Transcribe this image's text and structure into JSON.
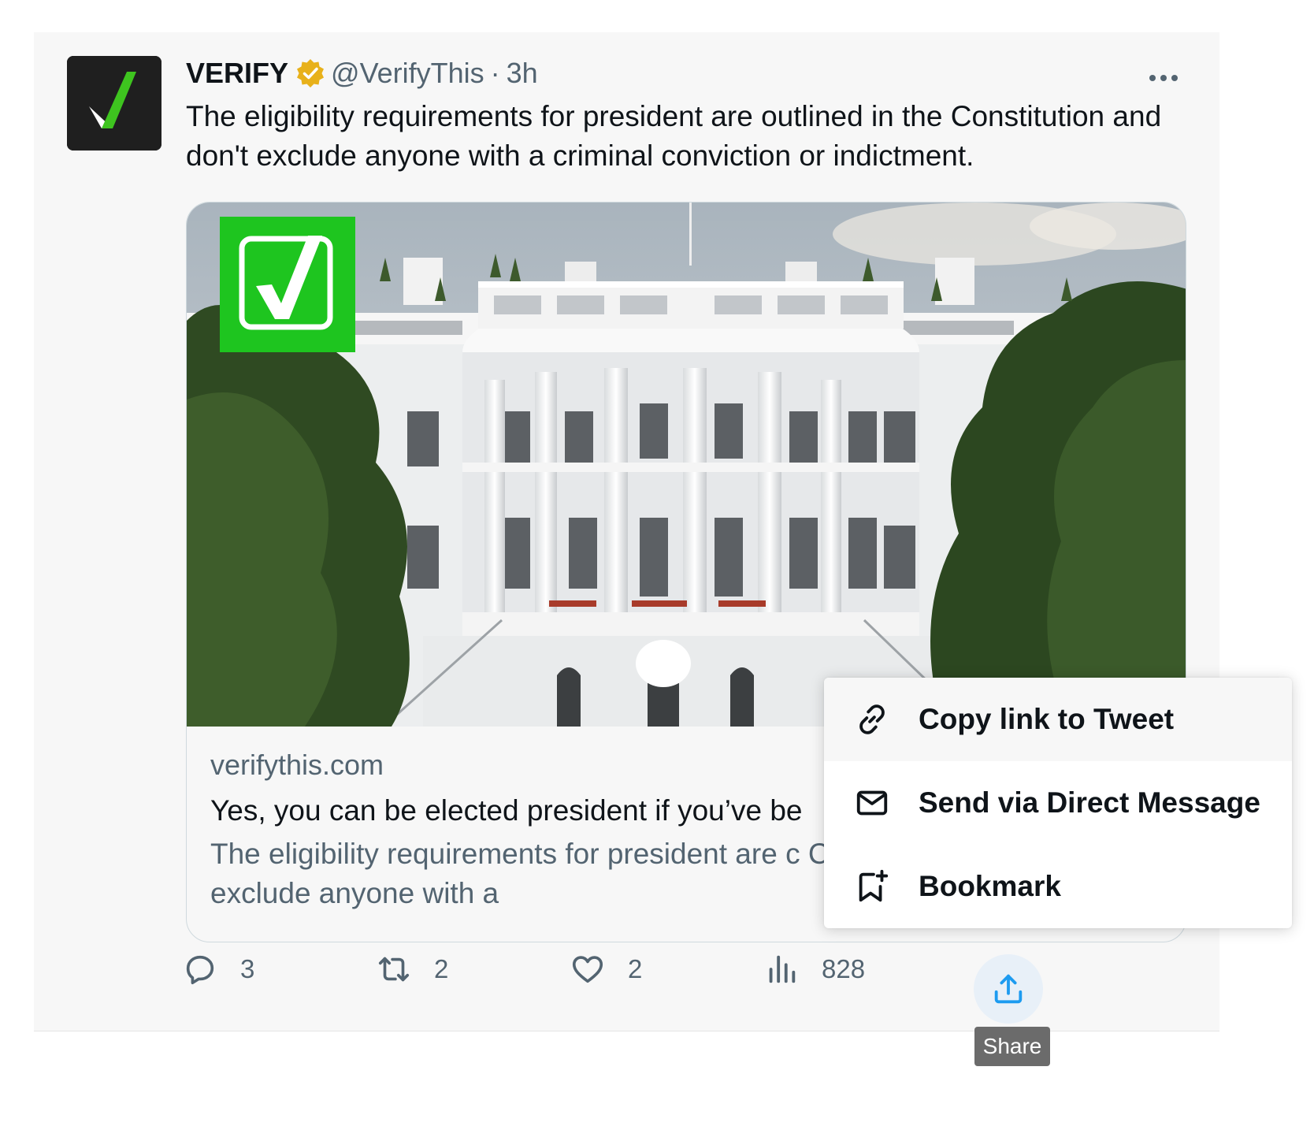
{
  "tweet": {
    "display_name": "VERIFY",
    "verified_icon": "gold-verified-badge-icon",
    "handle": "@VerifyThis",
    "separator": "·",
    "time": "3h",
    "text": "The eligibility requirements for president are outlined in the Constitution and don't exclude anyone with a criminal conviction or indictment.",
    "more_icon": "more-horizontal-icon"
  },
  "card": {
    "image": "white-house-photo",
    "domain": "verifythis.com",
    "title": "Yes, you can be elected president if you’ve be",
    "description": "The eligibility requirements for president are c Constitution and don't exclude anyone with a"
  },
  "actions": {
    "reply": {
      "icon": "reply-icon",
      "count": "3"
    },
    "retweet": {
      "icon": "retweet-icon",
      "count": "2"
    },
    "like": {
      "icon": "heart-icon",
      "count": "2"
    },
    "views": {
      "icon": "views-icon",
      "count": "828"
    },
    "share": {
      "icon": "share-icon"
    }
  },
  "tooltip": {
    "text": "Share"
  },
  "share_menu": {
    "items": [
      {
        "icon": "link-icon",
        "label": "Copy link to Tweet"
      },
      {
        "icon": "mail-icon",
        "label": "Send via Direct Message"
      },
      {
        "icon": "bookmark-add-icon",
        "label": "Bookmark"
      }
    ]
  },
  "colors": {
    "verify_green": "#3ec41f",
    "share_blue": "#1d9bf0",
    "gold_badge": "#e8b11a",
    "muted_text": "#536471"
  }
}
